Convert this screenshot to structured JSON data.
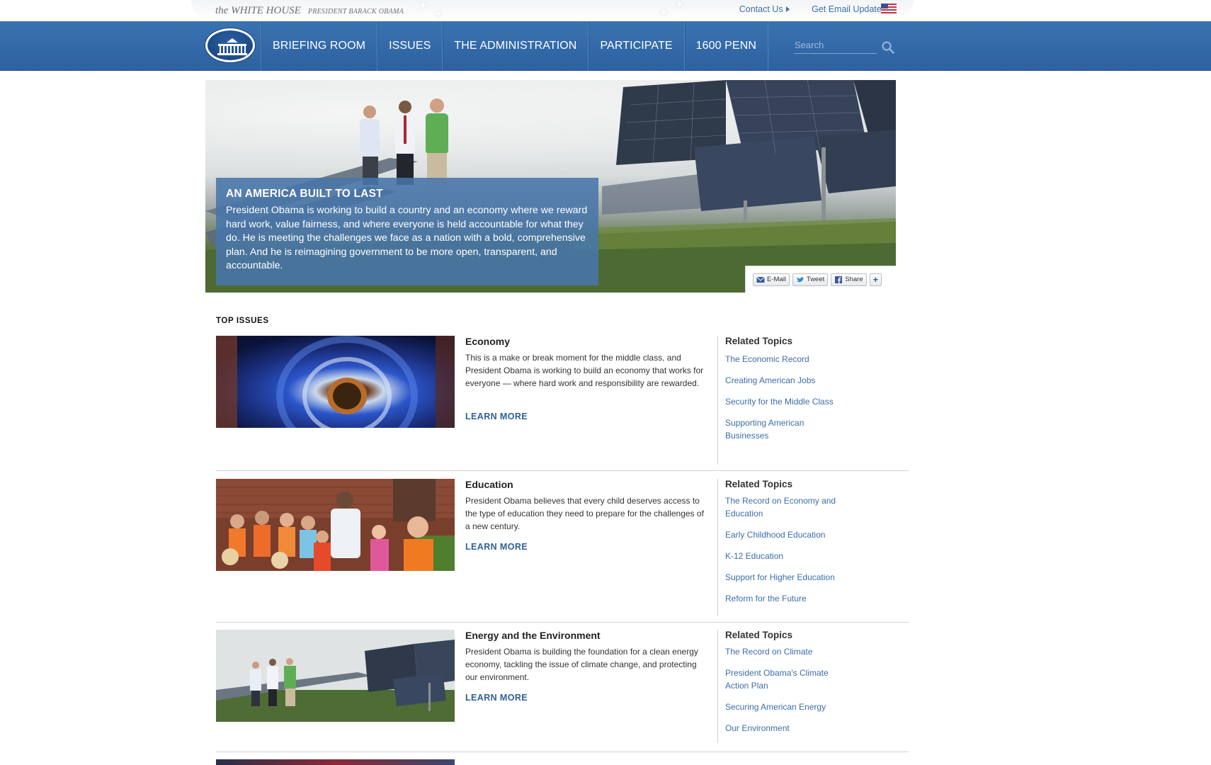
{
  "utility": {
    "brand_main": "the WHITE HOUSE",
    "brand_sub": "PRESIDENT BARACK OBAMA",
    "contact_label": "Contact Us",
    "email_label": "Get Email Updates"
  },
  "nav": {
    "items": [
      {
        "label": "BRIEFING ROOM"
      },
      {
        "label": "ISSUES"
      },
      {
        "label": "THE ADMINISTRATION"
      },
      {
        "label": "PARTICIPATE"
      },
      {
        "label": "1600 PENN"
      }
    ],
    "search_placeholder": "Search"
  },
  "hero": {
    "title": "AN AMERICA BUILT TO LAST",
    "text": "President Obama is working to build a country and an economy where we reward hard work, value fairness, and where everyone is held accountable for what they do. He is meeting the challenges we face as a nation with a bold, comprehensive plan. And he is reimagining government to be more open, transparent, and accountable.",
    "share": {
      "email": "E-Mail",
      "tweet": "Tweet",
      "share": "Share",
      "more": "+"
    }
  },
  "top_issues": {
    "heading": "TOP ISSUES",
    "related_heading": "Related Topics",
    "learn_more": "LEARN MORE",
    "items": [
      {
        "title": "Economy",
        "desc": "This is a make or break moment for the middle class, and President Obama is working to build an economy that works for everyone — where hard work and responsibility are rewarded.",
        "related": [
          "The Economic Record",
          "Creating American Jobs",
          "Security for the Middle Class",
          "Supporting American Businesses"
        ]
      },
      {
        "title": "Education",
        "desc": "President Obama believes that every child deserves access to the type of education they need to prepare for the challenges of a new century.",
        "related": [
          "The Record on Economy and Education",
          "Early Childhood Education",
          "K-12 Education",
          "Support for Higher Education",
          "Reform for the Future"
        ]
      },
      {
        "title": "Energy and the Environment",
        "desc": "President Obama is building the foundation for a clean energy economy, tackling the issue of climate change, and protecting our environment.",
        "related": [
          "The Record on Climate",
          "President Obama's Climate Action Plan",
          "Securing American Energy",
          "Our Environment"
        ]
      }
    ]
  }
}
